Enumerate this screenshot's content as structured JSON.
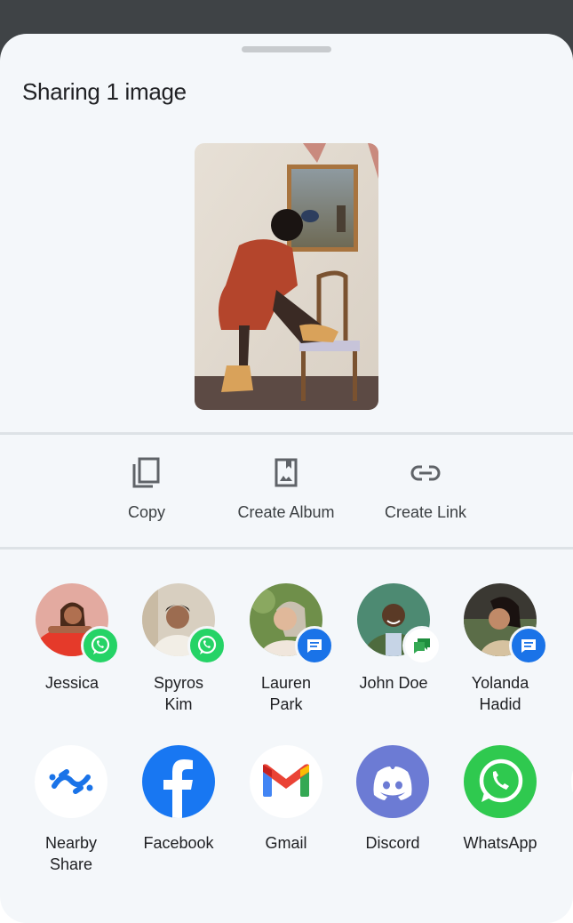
{
  "sheet": {
    "title": "Sharing 1 image"
  },
  "preview": {
    "description": "Photo of a person in a red coat posing with one foot on a wooden chair in front of a framed painting"
  },
  "actions": [
    {
      "label": "Copy",
      "icon": "copy-icon"
    },
    {
      "label": "Create Album",
      "icon": "album-icon"
    },
    {
      "label": "Create Link",
      "icon": "link-icon"
    }
  ],
  "people": [
    {
      "name_line1": "Jessica",
      "name_line2": "",
      "badge": "whatsapp"
    },
    {
      "name_line1": "Spyros",
      "name_line2": "Kim",
      "badge": "whatsapp"
    },
    {
      "name_line1": "Lauren",
      "name_line2": "Park",
      "badge": "messages"
    },
    {
      "name_line1": "John Doe",
      "name_line2": "",
      "badge": "google-chat"
    },
    {
      "name_line1": "Yolanda",
      "name_line2": "Hadid",
      "badge": "messages"
    }
  ],
  "apps": [
    {
      "name_line1": "Nearby",
      "name_line2": "Share",
      "icon": "nearby-share-icon"
    },
    {
      "name_line1": "Facebook",
      "name_line2": "",
      "icon": "facebook-icon"
    },
    {
      "name_line1": "Gmail",
      "name_line2": "",
      "icon": "gmail-icon"
    },
    {
      "name_line1": "Discord",
      "name_line2": "",
      "icon": "discord-icon"
    },
    {
      "name_line1": "WhatsApp",
      "name_line2": "",
      "icon": "whatsapp-icon"
    }
  ],
  "colors": {
    "scrim": "#3f4346",
    "sheet_bg": "#f4f7fa",
    "whatsapp_green": "#25d366",
    "messages_blue": "#1a73e8",
    "facebook_blue": "#1877f2",
    "discord_blurple": "#5865f2",
    "chat_green": "#1e8e3e"
  }
}
